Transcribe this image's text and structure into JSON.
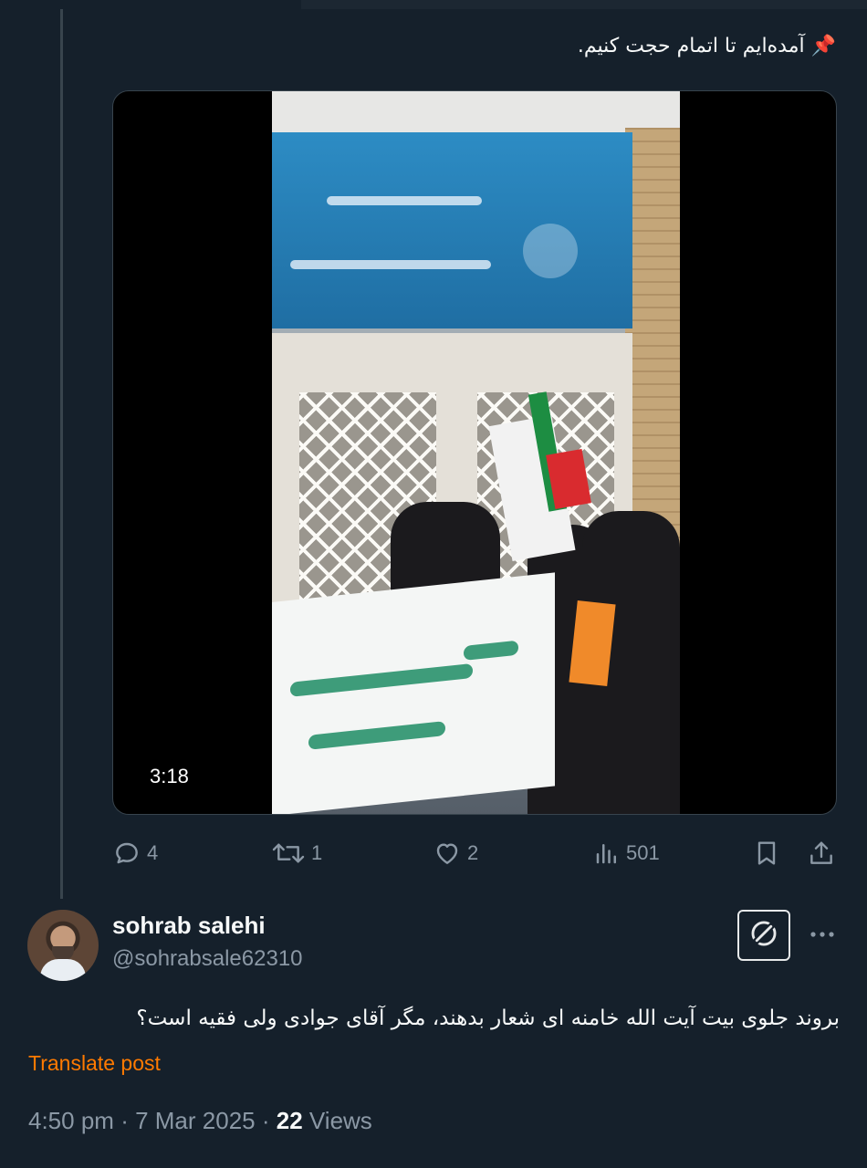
{
  "post": {
    "pin_emoji": "📌",
    "text": "آمده‌ایم تا اتمام حجت کنیم.",
    "media": {
      "duration": "3:18"
    },
    "actions": {
      "replies": "4",
      "reposts": "1",
      "likes": "2",
      "views": "501"
    }
  },
  "reply": {
    "display_name": "sohrab salehi",
    "handle": "@sohrabsale62310",
    "text": "بروند جلوی بیت آیت الله خامنه ای شعار بدهند، مگر آقای جوادی ولی فقیه است؟",
    "translate_label": "Translate post",
    "time": "4:50 pm",
    "date": "7 Mar 2025",
    "views_count": "22",
    "views_label": "Views",
    "separator": "·"
  },
  "colors": {
    "background": "#15202b",
    "muted": "#8b98a5",
    "translate": "#ff7a00"
  },
  "icons": [
    "reply-icon",
    "repost-icon",
    "like-icon",
    "views-icon",
    "bookmark-icon",
    "share-icon",
    "grok-icon",
    "more-icon"
  ]
}
